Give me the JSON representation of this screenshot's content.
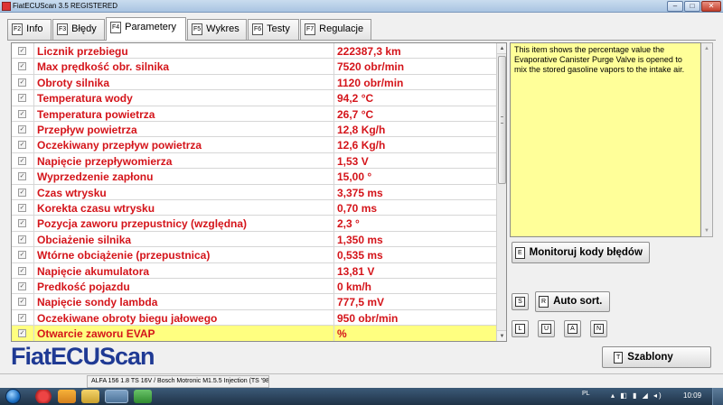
{
  "window": {
    "title": "FiatECUScan 3.5 REGISTERED",
    "min_glyph": "–",
    "max_glyph": "□",
    "close_glyph": "✕"
  },
  "tabs": [
    {
      "key": "F2",
      "label": "Info"
    },
    {
      "key": "F3",
      "label": "Błędy"
    },
    {
      "key": "F4",
      "label": "Parametery",
      "active": true
    },
    {
      "key": "F5",
      "label": "Wykres"
    },
    {
      "key": "F6",
      "label": "Testy"
    },
    {
      "key": "F7",
      "label": "Regulacje"
    }
  ],
  "checkbox_glyph": "✓",
  "parameters": [
    {
      "name": "Licznik przebiegu",
      "value": "222387,3 km"
    },
    {
      "name": "Max prędkość obr. silnika",
      "value": "7520 obr/min"
    },
    {
      "name": "Obroty silnika",
      "value": "1120 obr/min"
    },
    {
      "name": "Temperatura wody",
      "value": "94,2 °C"
    },
    {
      "name": "Temperatura powietrza",
      "value": "26,7 °C"
    },
    {
      "name": "Przepływ powietrza",
      "value": "12,8 Kg/h"
    },
    {
      "name": "Oczekiwany przepływ powietrza",
      "value": "12,6 Kg/h"
    },
    {
      "name": "Napięcie przepływomierza",
      "value": "1,53 V"
    },
    {
      "name": "Wyprzedzenie zapłonu",
      "value": "15,00 °"
    },
    {
      "name": "Czas wtrysku",
      "value": "3,375 ms"
    },
    {
      "name": "Korekta czasu wtrysku",
      "value": "0,70 ms"
    },
    {
      "name": "Pozycja zaworu przepustnicy (względna)",
      "value": "2,3 °"
    },
    {
      "name": "Obciażenie silnika",
      "value": "1,350 ms"
    },
    {
      "name": "Wtórne obciążenie (przepustnica)",
      "value": "0,535 ms"
    },
    {
      "name": "Napięcie akumulatora",
      "value": "13,81 V"
    },
    {
      "name": "Predkość pojazdu",
      "value": "0 km/h"
    },
    {
      "name": "Napięcie sondy lambda",
      "value": "777,5 mV"
    },
    {
      "name": "Oczekiwane obroty biegu jałowego",
      "value": "950 obr/min"
    },
    {
      "name": "Otwarcie zaworu EVAP",
      "value": "%",
      "selected": true
    }
  ],
  "scroll": {
    "up": "▲",
    "down": "▼"
  },
  "info_text": "This item shows the percentage value the Evaporative Canister Purge Valve is opened to mix the stored gasoline vapors to the intake air.",
  "buttons": {
    "monitor": {
      "key": "E",
      "label": "Monitoruj kody błędów"
    },
    "s_key": "S",
    "auto_sort": {
      "key": "R",
      "label": "Auto sort."
    },
    "l_key": "L",
    "u_key": "U",
    "a_key": "A",
    "n_key": "N",
    "szablony": {
      "key": "T",
      "label": "Szablony"
    }
  },
  "logo": "FiatECUScan",
  "status": {
    "vehicle": "ALFA 156 1.8 TS 16V / Bosch Motronic M1.5.5 Injection (TS '98)"
  },
  "taskbar": {
    "lang": "PL",
    "tray_glyphs": "▴ ◧ ▮ ◢ ◂)",
    "clock": "10:09"
  }
}
